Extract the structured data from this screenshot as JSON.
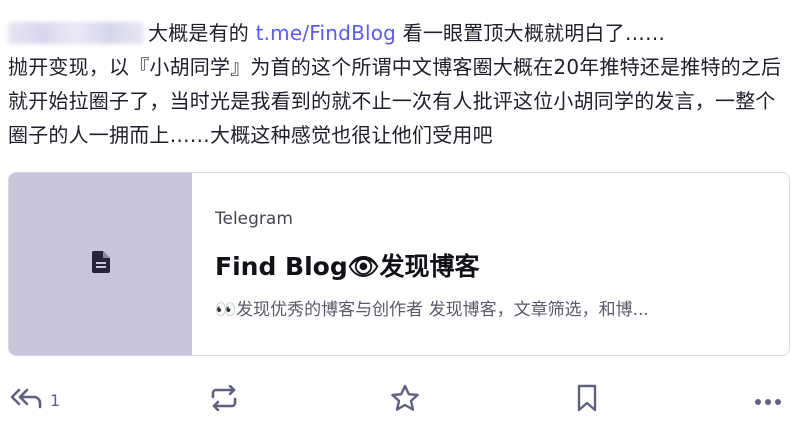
{
  "post": {
    "author_redacted": "",
    "intro_text": "大概是有的 ",
    "link_text": "t.me/FindBlog",
    "after_link": " 看一眼置顶大概就明白了……",
    "body": "抛开变现，以『小胡同学』为首的这个所谓中文博客圈大概在20年推特还是推特的之后就开始拉圈子了，当时光是我看到的就不止一次有人批评这位小胡同学的发言，一整个圈子的人一拥而上……大概这种感觉也很让他们受用吧"
  },
  "card": {
    "icon": "file-icon",
    "provider": "Telegram",
    "title": "Find Blog👁发现博客",
    "description": "👀发现优秀的博客与创作者 发现博客，文章筛选，和博..."
  },
  "actions": {
    "reply_count": "1",
    "icon_color": "#606085"
  }
}
